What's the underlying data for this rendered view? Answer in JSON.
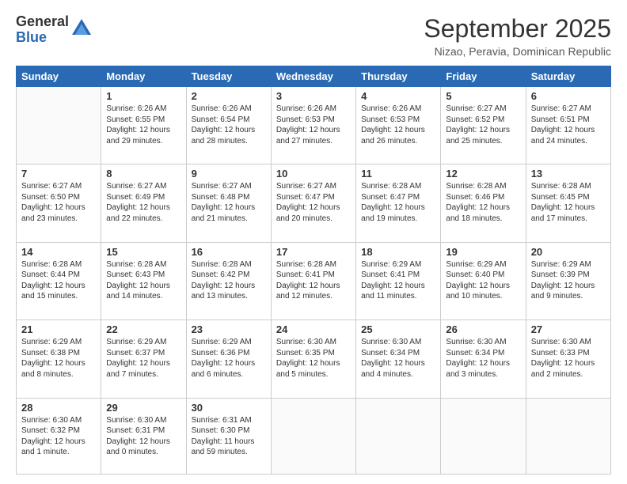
{
  "logo": {
    "general": "General",
    "blue": "Blue"
  },
  "header": {
    "month": "September 2025",
    "location": "Nizao, Peravia, Dominican Republic"
  },
  "days_of_week": [
    "Sunday",
    "Monday",
    "Tuesday",
    "Wednesday",
    "Thursday",
    "Friday",
    "Saturday"
  ],
  "weeks": [
    [
      {
        "day": "",
        "info": ""
      },
      {
        "day": "1",
        "info": "Sunrise: 6:26 AM\nSunset: 6:55 PM\nDaylight: 12 hours\nand 29 minutes."
      },
      {
        "day": "2",
        "info": "Sunrise: 6:26 AM\nSunset: 6:54 PM\nDaylight: 12 hours\nand 28 minutes."
      },
      {
        "day": "3",
        "info": "Sunrise: 6:26 AM\nSunset: 6:53 PM\nDaylight: 12 hours\nand 27 minutes."
      },
      {
        "day": "4",
        "info": "Sunrise: 6:26 AM\nSunset: 6:53 PM\nDaylight: 12 hours\nand 26 minutes."
      },
      {
        "day": "5",
        "info": "Sunrise: 6:27 AM\nSunset: 6:52 PM\nDaylight: 12 hours\nand 25 minutes."
      },
      {
        "day": "6",
        "info": "Sunrise: 6:27 AM\nSunset: 6:51 PM\nDaylight: 12 hours\nand 24 minutes."
      }
    ],
    [
      {
        "day": "7",
        "info": "Sunrise: 6:27 AM\nSunset: 6:50 PM\nDaylight: 12 hours\nand 23 minutes."
      },
      {
        "day": "8",
        "info": "Sunrise: 6:27 AM\nSunset: 6:49 PM\nDaylight: 12 hours\nand 22 minutes."
      },
      {
        "day": "9",
        "info": "Sunrise: 6:27 AM\nSunset: 6:48 PM\nDaylight: 12 hours\nand 21 minutes."
      },
      {
        "day": "10",
        "info": "Sunrise: 6:27 AM\nSunset: 6:47 PM\nDaylight: 12 hours\nand 20 minutes."
      },
      {
        "day": "11",
        "info": "Sunrise: 6:28 AM\nSunset: 6:47 PM\nDaylight: 12 hours\nand 19 minutes."
      },
      {
        "day": "12",
        "info": "Sunrise: 6:28 AM\nSunset: 6:46 PM\nDaylight: 12 hours\nand 18 minutes."
      },
      {
        "day": "13",
        "info": "Sunrise: 6:28 AM\nSunset: 6:45 PM\nDaylight: 12 hours\nand 17 minutes."
      }
    ],
    [
      {
        "day": "14",
        "info": "Sunrise: 6:28 AM\nSunset: 6:44 PM\nDaylight: 12 hours\nand 15 minutes."
      },
      {
        "day": "15",
        "info": "Sunrise: 6:28 AM\nSunset: 6:43 PM\nDaylight: 12 hours\nand 14 minutes."
      },
      {
        "day": "16",
        "info": "Sunrise: 6:28 AM\nSunset: 6:42 PM\nDaylight: 12 hours\nand 13 minutes."
      },
      {
        "day": "17",
        "info": "Sunrise: 6:28 AM\nSunset: 6:41 PM\nDaylight: 12 hours\nand 12 minutes."
      },
      {
        "day": "18",
        "info": "Sunrise: 6:29 AM\nSunset: 6:41 PM\nDaylight: 12 hours\nand 11 minutes."
      },
      {
        "day": "19",
        "info": "Sunrise: 6:29 AM\nSunset: 6:40 PM\nDaylight: 12 hours\nand 10 minutes."
      },
      {
        "day": "20",
        "info": "Sunrise: 6:29 AM\nSunset: 6:39 PM\nDaylight: 12 hours\nand 9 minutes."
      }
    ],
    [
      {
        "day": "21",
        "info": "Sunrise: 6:29 AM\nSunset: 6:38 PM\nDaylight: 12 hours\nand 8 minutes."
      },
      {
        "day": "22",
        "info": "Sunrise: 6:29 AM\nSunset: 6:37 PM\nDaylight: 12 hours\nand 7 minutes."
      },
      {
        "day": "23",
        "info": "Sunrise: 6:29 AM\nSunset: 6:36 PM\nDaylight: 12 hours\nand 6 minutes."
      },
      {
        "day": "24",
        "info": "Sunrise: 6:30 AM\nSunset: 6:35 PM\nDaylight: 12 hours\nand 5 minutes."
      },
      {
        "day": "25",
        "info": "Sunrise: 6:30 AM\nSunset: 6:34 PM\nDaylight: 12 hours\nand 4 minutes."
      },
      {
        "day": "26",
        "info": "Sunrise: 6:30 AM\nSunset: 6:34 PM\nDaylight: 12 hours\nand 3 minutes."
      },
      {
        "day": "27",
        "info": "Sunrise: 6:30 AM\nSunset: 6:33 PM\nDaylight: 12 hours\nand 2 minutes."
      }
    ],
    [
      {
        "day": "28",
        "info": "Sunrise: 6:30 AM\nSunset: 6:32 PM\nDaylight: 12 hours\nand 1 minute."
      },
      {
        "day": "29",
        "info": "Sunrise: 6:30 AM\nSunset: 6:31 PM\nDaylight: 12 hours\nand 0 minutes."
      },
      {
        "day": "30",
        "info": "Sunrise: 6:31 AM\nSunset: 6:30 PM\nDaylight: 11 hours\nand 59 minutes."
      },
      {
        "day": "",
        "info": ""
      },
      {
        "day": "",
        "info": ""
      },
      {
        "day": "",
        "info": ""
      },
      {
        "day": "",
        "info": ""
      }
    ]
  ]
}
